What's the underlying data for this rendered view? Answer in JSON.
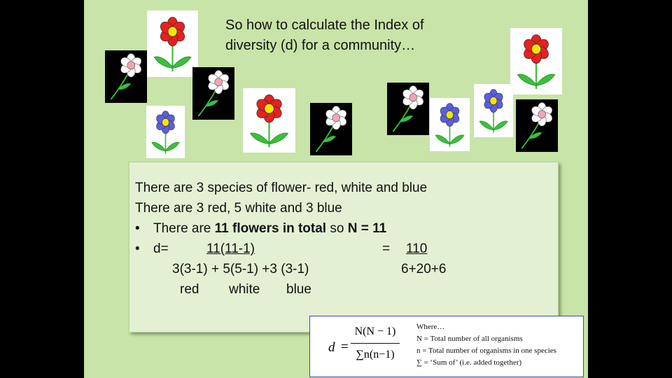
{
  "title": "So how to calculate the Index of diversity (d) for a community…",
  "colors": {
    "background": "#c8e4a8",
    "red_petal": "#e8201f",
    "white_petal": "#ffffff",
    "blue_petal": "#5a5ee0",
    "center_yellow": "#f5e600",
    "center_pink": "#f4a4b4",
    "stem": "#3bbf3b"
  },
  "flowers": [
    {
      "species": "red",
      "icon": "red-flower-icon"
    },
    {
      "species": "white",
      "icon": "white-flower-icon"
    },
    {
      "species": "white",
      "icon": "white-flower-icon"
    },
    {
      "species": "blue",
      "icon": "blue-flower-icon"
    },
    {
      "species": "red",
      "icon": "red-flower-icon"
    },
    {
      "species": "white",
      "icon": "white-flower-icon"
    },
    {
      "species": "white",
      "icon": "white-flower-icon"
    },
    {
      "species": "blue",
      "icon": "blue-flower-icon"
    },
    {
      "species": "blue",
      "icon": "blue-flower-icon"
    },
    {
      "species": "red",
      "icon": "red-flower-icon"
    },
    {
      "species": "white",
      "icon": "white-flower-icon"
    }
  ],
  "textbox": {
    "line1": "There are 3 species of flower- red, white and blue",
    "line2": "There are 3 red, 5 white and 3 blue",
    "bullet_char": "•",
    "bullet1_pre": "There are ",
    "bullet1_bold1": "11 flowers in total",
    "bullet1_mid": " so ",
    "bullet1_bold2": "N = 11",
    "d_label": "d=",
    "numerator": "11(11-1)",
    "denominator": "3(3-1) + 5(5-1) +3 (3-1)",
    "equals": "=",
    "result_numerator": "110",
    "result_denominator": "6+20+6",
    "label_red": "red",
    "label_white": "white",
    "label_blue": "blue"
  },
  "formula": {
    "d": "d",
    "equals": "=",
    "numerator": "N(N − 1)",
    "denominator": "∑n(n−1)",
    "notes": [
      "Where…",
      "N = Total number of all organisms",
      "n = Total number of organisms in one species",
      "∑ = ‘Sum of’ (i.e. added together)"
    ]
  }
}
